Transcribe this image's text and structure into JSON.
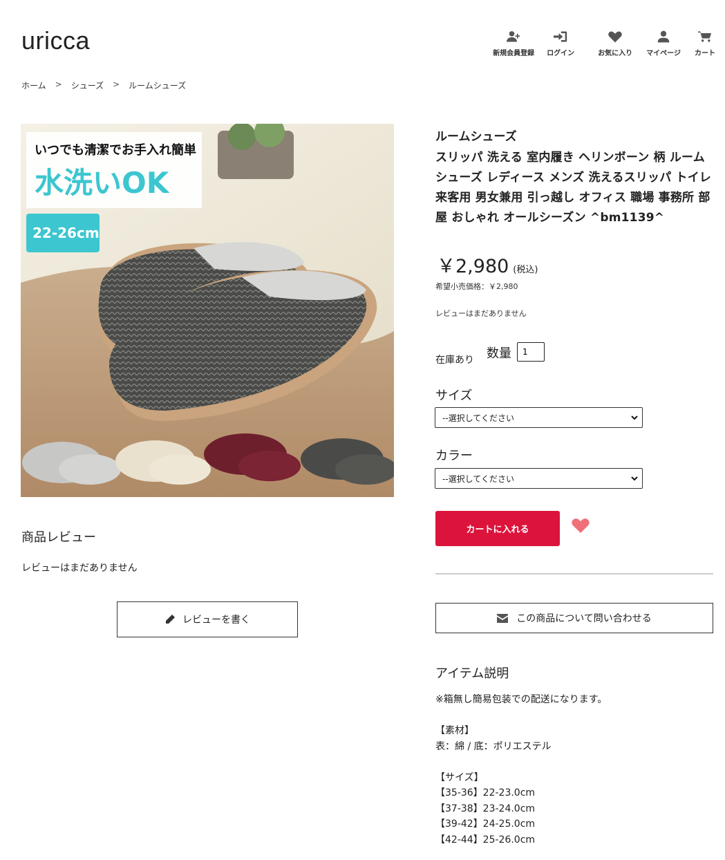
{
  "header": {
    "logo": "uricca",
    "nav": [
      {
        "label": "新規会員登録",
        "icon": "user-plus-icon"
      },
      {
        "label": "ログイン",
        "icon": "sign-in-icon"
      },
      {
        "label": "お気に入り",
        "icon": "heart-icon"
      },
      {
        "label": "マイページ",
        "icon": "user-icon"
      },
      {
        "label": "カート",
        "icon": "cart-icon"
      }
    ]
  },
  "breadcrumb": {
    "items": [
      "ホーム",
      "シューズ",
      "ルームシューズ"
    ],
    "separator": ">"
  },
  "image": {
    "headline": "いつでも清潔でお手入れ簡単",
    "big_text": "水洗いOK",
    "size_badge": "22-26cm"
  },
  "product": {
    "category": "ルームシューズ",
    "title": "スリッパ 洗える 室内履き ヘリンボーン 柄 ルームシューズ レディース メンズ 洗えるスリッパ トイレ 来客用 男女兼用 引っ越し オフィス 職場 事務所 部屋 おしゃれ オールシーズン ^bm1139^",
    "price": "￥2,980",
    "tax_label": "(税込)",
    "msrp": "希望小売価格：￥2,980",
    "review_status": "レビューはまだありません",
    "stock": "在庫あり",
    "quantity_label": "数量",
    "quantity_value": "1",
    "size_label": "サイズ",
    "size_select": "--選択してください",
    "color_label": "カラー",
    "color_select": "--選択してください",
    "cart_button": "カートに入れる",
    "contact_button": "この商品について問い合わせる",
    "favorite_color": "#f0707a",
    "cart_color": "#dc143c"
  },
  "reviews": {
    "heading": "商品レビュー",
    "none": "レビューはまだありません",
    "write_button": "レビューを書く"
  },
  "description": {
    "heading": "アイテム説明",
    "lines": [
      "※箱無し簡易包装での配送になります。",
      "",
      "【素材】",
      "表：綿 / 底：ポリエステル",
      "",
      "【サイズ】",
      "【35-36】22-23.0cm",
      "【37-38】23-24.0cm",
      "【39-42】24-25.0cm",
      "【42-44】25-26.0cm"
    ]
  }
}
